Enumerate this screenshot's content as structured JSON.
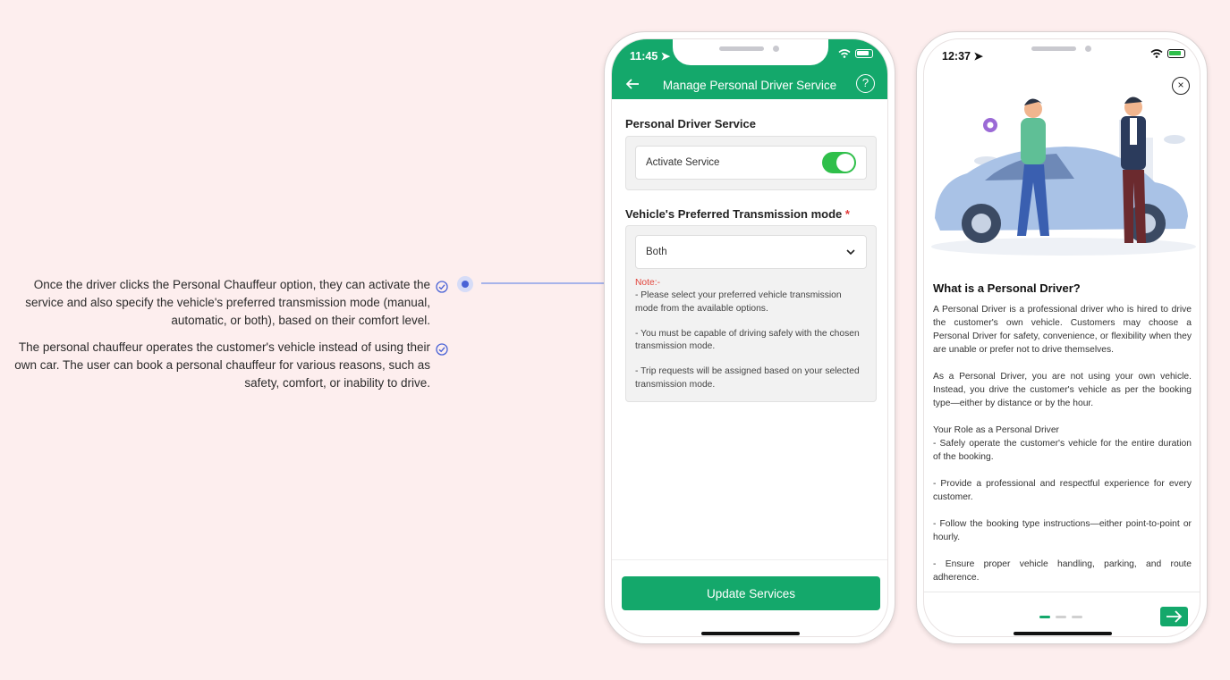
{
  "annotations": {
    "first": "Once the driver clicks the Personal Chauffeur option, they can activate the service and also specify the vehicle's preferred transmission mode (manual, automatic, or both), based on their comfort level.",
    "second": "The personal chauffeur operates the customer's vehicle instead of using their own car. The user can book a personal chauffeur for various reasons, such as safety, comfort, or inability to drive."
  },
  "phone1": {
    "status_time": "11:45",
    "title": "Manage Personal Driver Service",
    "help_symbol": "?",
    "section1_title": "Personal Driver Service",
    "activate_label": "Activate Service",
    "activate_on": true,
    "section2_title": "Vehicle's Preferred Transmission mode",
    "required_mark": "*",
    "transmission_value": "Both",
    "note_label": "Note:-",
    "notes": [
      "- Please select your preferred vehicle transmission mode from the available options.",
      "- You must be capable of driving safely with the chosen transmission mode.",
      "- Trip requests will be assigned based on your selected transmission mode."
    ],
    "update_button": "Update Services"
  },
  "phone2": {
    "status_time": "12:37",
    "close_symbol": "×",
    "heading": "What is a Personal Driver?",
    "paragraphs": [
      "A Personal Driver is a professional driver who is hired to drive the customer's own vehicle. Customers may choose a Personal Driver for safety, convenience, or flexibility when they are unable or prefer not to drive themselves.",
      "As a Personal Driver, you are not using your own vehicle. Instead, you drive the customer's vehicle as per the booking type—either by distance or by the hour.",
      "Your Role as a Personal Driver\n- Safely operate the customer's vehicle for the entire duration of the booking.",
      "- Provide a professional and respectful experience for every customer.",
      "- Follow the booking type instructions—either point-to-point or hourly.",
      "- Ensure proper vehicle handling, parking, and route adherence."
    ],
    "page_dots": 3,
    "active_dot": 1
  },
  "colors": {
    "brand_green": "#14a86b",
    "toggle_green": "#2fbf4a",
    "note_red": "#e2453c",
    "annotation_blue": "#4a63d6"
  },
  "icons": [
    "check-circle-icon",
    "back-arrow-icon",
    "help-icon",
    "chevron-down-icon",
    "close-icon",
    "arrow-right-icon",
    "wifi-icon",
    "battery-icon",
    "location-arrow-icon"
  ]
}
